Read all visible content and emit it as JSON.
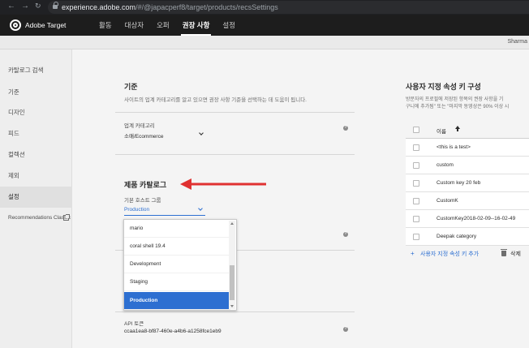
{
  "browser": {
    "url_host": "experience.adobe.com",
    "url_path": "/#/@japacperf8/target/products/recsSettings"
  },
  "app": {
    "brand": "Adobe Target",
    "nav": [
      "활동",
      "대상자",
      "오퍼",
      "권장 사항",
      "설정"
    ],
    "active_nav": "권장 사항",
    "user": "Sharma"
  },
  "sidebar": {
    "items": [
      "카탈로그 검색",
      "기준",
      "디자인",
      "피드",
      "컬렉션",
      "제외",
      "설정"
    ],
    "active": "설정",
    "external_link": "Recommendations Classic"
  },
  "criteria": {
    "title": "기준",
    "description": "사이트의 업계 카테고리를 알고 있으면 권장 사항 기준을 선택하는 데 도움이 됩니다.",
    "industry_label": "업계 카테고리",
    "industry_value": "소매/Ecommerce"
  },
  "catalog": {
    "title": "제품 카탈로그",
    "host_group_label": "기본 호스트 그룹",
    "host_group_value": "Production",
    "options": [
      "mario",
      "coral shell 19.4",
      "Development",
      "Staging",
      "Production"
    ],
    "selected": "Production",
    "api_token_label": "API 토큰",
    "api_token_value": "ccaa1ea8-bf87-460e-a4b6-a1258fce1eb9"
  },
  "custom_attrs": {
    "title": "사용자 지정 속성 키 구성",
    "description_line1": "방문자의 프로필에 저장된 항목의 권장 사항을 기",
    "description_line2": "구니에 추가됨\" 또는 \"마지막 동영상은 90% 이상 시",
    "column_name": "이름",
    "rows": [
      "<this is a test>",
      "custom",
      "Custom key 20 feb",
      "CustomK",
      "CustomKey2018-02-09--16-02-49",
      "Deepak category"
    ],
    "add_label": "사용자 지정 속성 키 추가",
    "delete_label": "삭제"
  },
  "colors": {
    "accent": "#2d6fd1",
    "header_bg": "#1d1d1d",
    "annotation_arrow": "#e03131"
  }
}
